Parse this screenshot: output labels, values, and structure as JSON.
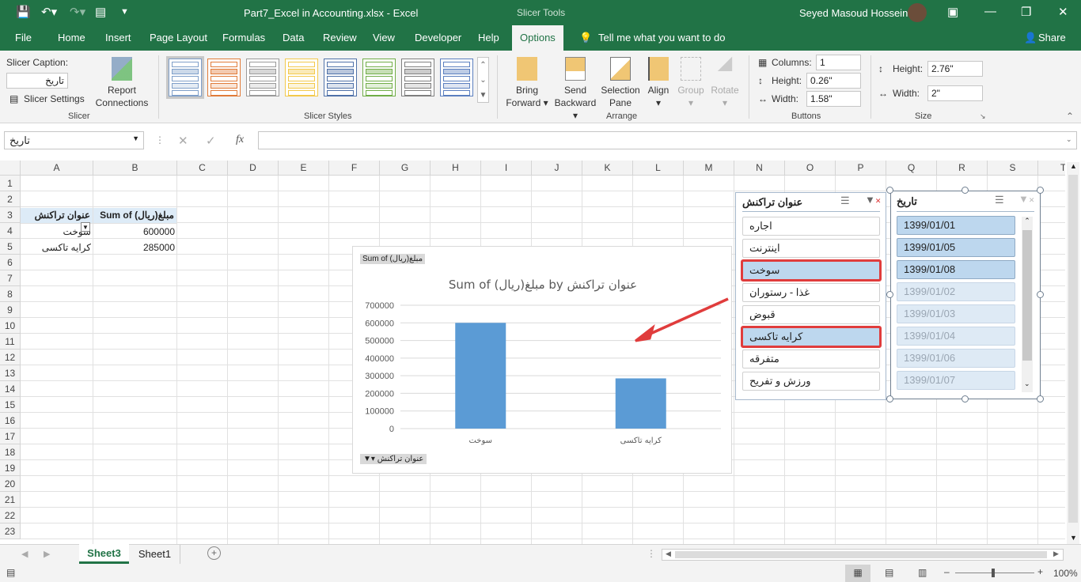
{
  "window": {
    "title": "Part7_Excel in Accounting.xlsx  -  Excel",
    "context_tab": "Slicer Tools",
    "user": "Seyed Masoud Hosseini"
  },
  "menu": {
    "tabs": [
      "File",
      "Home",
      "Insert",
      "Page Layout",
      "Formulas",
      "Data",
      "Review",
      "View",
      "Developer",
      "Help",
      "Options"
    ],
    "active": "Options",
    "tell_me": "Tell me what you want to do",
    "share": "Share"
  },
  "ribbon": {
    "slicer_caption_label": "Slicer Caption:",
    "slicer_caption_value": "تاریخ",
    "slicer_settings": "Slicer Settings",
    "report_connections_1": "Report",
    "report_connections_2": "Connections",
    "group_slicer": "Slicer",
    "group_styles": "Slicer Styles",
    "style_colors": [
      "#7f9fc9",
      "#e07b39",
      "#9a9a9a",
      "#f2c94c",
      "#4f71a8",
      "#70ad47",
      "#7f7f7f",
      "#5b7fbf"
    ],
    "bring_forward": [
      "Bring",
      "Forward"
    ],
    "send_backward": [
      "Send",
      "Backward"
    ],
    "selection_pane": [
      "Selection",
      "Pane"
    ],
    "align": "Align",
    "group": "Group",
    "rotate": "Rotate",
    "group_arrange": "Arrange",
    "columns_label": "Columns:",
    "columns_value": "1",
    "btn_height_label": "Height:",
    "btn_height_value": "0.26\"",
    "btn_width_label": "Width:",
    "btn_width_value": "1.58\"",
    "group_buttons": "Buttons",
    "size_height_label": "Height:",
    "size_height_value": "2.76\"",
    "size_width_label": "Width:",
    "size_width_value": "2\"",
    "group_size": "Size"
  },
  "formula_bar": {
    "name_box": "تاریخ",
    "formula": "",
    "fx": "fx"
  },
  "sheet": {
    "columns": [
      "A",
      "B",
      "C",
      "D",
      "E",
      "F",
      "G",
      "H",
      "I",
      "J",
      "K",
      "L",
      "M",
      "N",
      "O",
      "P",
      "Q",
      "R",
      "S",
      "T"
    ],
    "rows": 23,
    "pivot": {
      "header_row": [
        "عنوان تراکنش",
        "Sum of مبلغ(ریال)"
      ],
      "rows": [
        [
          "سوخت",
          "600000"
        ],
        [
          "کرایه تاکسی",
          "285000"
        ]
      ]
    }
  },
  "chart": {
    "field_button_value": "Sum of مبلغ(ریال)",
    "field_button_axis": "عنوان تراکنش",
    "bar_color": "#5b9bd5"
  },
  "chart_data": {
    "type": "bar",
    "title": "Sum of مبلغ(ریال) by عنوان تراکنش",
    "categories": [
      "سوخت",
      "کرایه تاکسی"
    ],
    "values": [
      600000,
      285000
    ],
    "ylim": [
      0,
      700000
    ],
    "yticks": [
      "0",
      "100000",
      "200000",
      "300000",
      "400000",
      "500000",
      "600000",
      "700000"
    ],
    "grid": true,
    "legend": "none"
  },
  "slicer1": {
    "title": "عنوان تراکنش",
    "items": [
      {
        "label": "اجاره",
        "state": "normal"
      },
      {
        "label": "اینترنت",
        "state": "normal"
      },
      {
        "label": "سوخت",
        "state": "selected"
      },
      {
        "label": "غذا - رستوران",
        "state": "normal"
      },
      {
        "label": "قبوض",
        "state": "normal"
      },
      {
        "label": "کرایه تاکسی",
        "state": "selected"
      },
      {
        "label": "متفرقه",
        "state": "normal"
      },
      {
        "label": "ورزش و تفریح",
        "state": "normal"
      }
    ],
    "highlight_color": "#e03c3c"
  },
  "slicer2": {
    "title": "تاریخ",
    "items": [
      {
        "label": "1399/01/01",
        "state": "selected"
      },
      {
        "label": "1399/01/05",
        "state": "selected"
      },
      {
        "label": "1399/01/08",
        "state": "selected"
      },
      {
        "label": "1399/01/02",
        "state": "nodata"
      },
      {
        "label": "1399/01/03",
        "state": "nodata"
      },
      {
        "label": "1399/01/04",
        "state": "nodata"
      },
      {
        "label": "1399/01/06",
        "state": "nodata"
      },
      {
        "label": "1399/01/07",
        "state": "nodata"
      }
    ]
  },
  "sheet_tabs": {
    "tabs": [
      "Sheet3",
      "Sheet1"
    ],
    "active": "Sheet3"
  },
  "status": {
    "zoom": "100%"
  }
}
